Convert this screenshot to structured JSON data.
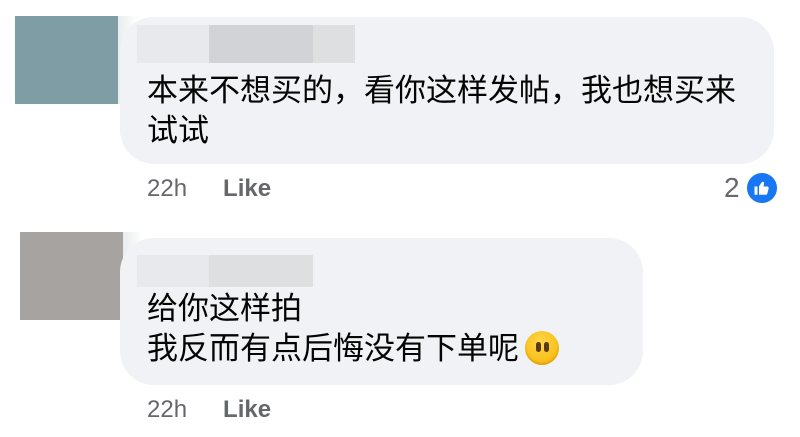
{
  "comments": [
    {
      "text": "本来不想买的，看你这样发帖，我也想买来试试",
      "time": "22h",
      "like_label": "Like",
      "reaction_count": "2",
      "reaction_icon": "thumbs-up-icon",
      "avatar_color": "#7f9da5"
    },
    {
      "text": "给你这样拍\n我反而有点后悔没有下单呢",
      "emoji": "hushed-face-emoji",
      "time": "22h",
      "like_label": "Like",
      "avatar_color": "#a7a3a1"
    }
  ],
  "colors": {
    "bubble": "#f0f2f5",
    "meta_text": "#65676b",
    "like_blue": "#1877f2"
  }
}
